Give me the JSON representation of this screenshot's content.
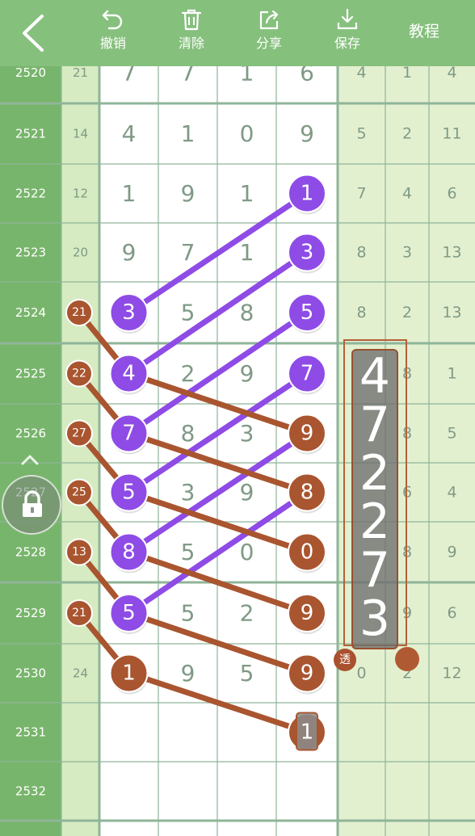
{
  "toolbar": {
    "undo_label": "撤销",
    "clear_label": "清除",
    "share_label": "分享",
    "save_label": "保存",
    "tutorial_label": "教程",
    "bg": "#86c07d"
  },
  "table": {
    "rows": [
      {
        "issue": "2520",
        "span": "21",
        "digits": [
          "7",
          "7",
          "1",
          "6"
        ],
        "stats": [
          "4",
          "1",
          "4"
        ]
      },
      {
        "issue": "2521",
        "span": "14",
        "digits": [
          "4",
          "1",
          "0",
          "9"
        ],
        "stats": [
          "5",
          "2",
          "11"
        ]
      },
      {
        "issue": "2522",
        "span": "12",
        "digits": [
          "1",
          "9",
          "1",
          ""
        ],
        "stats": [
          "7",
          "4",
          "6"
        ]
      },
      {
        "issue": "2523",
        "span": "20",
        "digits": [
          "9",
          "7",
          "1",
          ""
        ],
        "stats": [
          "8",
          "3",
          "13"
        ]
      },
      {
        "issue": "2524",
        "span": "",
        "digits": [
          "",
          "5",
          "8",
          ""
        ],
        "stats": [
          "8",
          "2",
          "13"
        ]
      },
      {
        "issue": "2525",
        "span": "",
        "digits": [
          "",
          "2",
          "9",
          ""
        ],
        "stats": [
          "",
          "8",
          "1"
        ]
      },
      {
        "issue": "2526",
        "span": "",
        "digits": [
          "",
          "8",
          "3",
          ""
        ],
        "stats": [
          "",
          "8",
          "5"
        ]
      },
      {
        "issue": "2527",
        "span": "",
        "digits": [
          "",
          "3",
          "9",
          ""
        ],
        "stats": [
          "",
          "6",
          "4"
        ]
      },
      {
        "issue": "2528",
        "span": "",
        "digits": [
          "",
          "5",
          "0",
          ""
        ],
        "stats": [
          "",
          "8",
          "9"
        ]
      },
      {
        "issue": "2529",
        "span": "",
        "digits": [
          "",
          "5",
          "2",
          ""
        ],
        "stats": [
          "",
          "9",
          "6"
        ]
      },
      {
        "issue": "2530",
        "span": "24",
        "digits": [
          "",
          "9",
          "5",
          ""
        ],
        "stats": [
          "0",
          "2",
          "12"
        ]
      },
      {
        "issue": "2531",
        "span": "",
        "digits": [
          "",
          "",
          "",
          ""
        ],
        "stats": [
          "",
          "",
          ""
        ]
      },
      {
        "issue": "2532",
        "span": "",
        "digits": [
          "",
          "",
          "",
          ""
        ],
        "stats": [
          "",
          "",
          ""
        ]
      }
    ]
  },
  "markers": {
    "purple": [
      {
        "row": 2,
        "col": 3,
        "value": "1"
      },
      {
        "row": 3,
        "col": 3,
        "value": "3"
      },
      {
        "row": 4,
        "col": 0,
        "value": "3"
      },
      {
        "row": 4,
        "col": 3,
        "value": "5"
      },
      {
        "row": 5,
        "col": 0,
        "value": "4"
      },
      {
        "row": 5,
        "col": 3,
        "value": "7"
      },
      {
        "row": 6,
        "col": 0,
        "value": "7"
      },
      {
        "row": 7,
        "col": 0,
        "value": "5"
      },
      {
        "row": 8,
        "col": 0,
        "value": "8"
      },
      {
        "row": 9,
        "col": 0,
        "value": "5"
      }
    ],
    "brown": [
      {
        "row": 10,
        "col": 0,
        "value": "1"
      },
      {
        "row": 6,
        "col": 3,
        "value": "9"
      },
      {
        "row": 7,
        "col": 3,
        "value": "8"
      },
      {
        "row": 8,
        "col": 3,
        "value": "0"
      },
      {
        "row": 9,
        "col": 3,
        "value": "9"
      },
      {
        "row": 10,
        "col": 3,
        "value": "9"
      },
      {
        "row": 11,
        "col": 3,
        "value": "1"
      }
    ],
    "span_badges": [
      {
        "row": 4,
        "value": "21"
      },
      {
        "row": 5,
        "value": "22"
      },
      {
        "row": 6,
        "value": "27"
      },
      {
        "row": 7,
        "value": "25"
      },
      {
        "row": 8,
        "value": "13"
      },
      {
        "row": 9,
        "value": "21"
      }
    ],
    "purple_lines": [
      [
        2,
        3,
        4,
        0
      ],
      [
        3,
        3,
        5,
        0
      ],
      [
        4,
        3,
        6,
        0
      ],
      [
        5,
        3,
        7,
        0
      ],
      [
        6,
        3,
        8,
        0
      ],
      [
        7,
        3,
        9,
        0
      ]
    ],
    "brown_lines": [
      [
        4,
        -1,
        5,
        0
      ],
      [
        5,
        -1,
        6,
        0
      ],
      [
        6,
        -1,
        7,
        0
      ],
      [
        7,
        -1,
        8,
        0
      ],
      [
        8,
        -1,
        9,
        0
      ],
      [
        9,
        -1,
        10,
        0
      ],
      [
        5,
        0,
        6,
        3
      ],
      [
        6,
        0,
        7,
        3
      ],
      [
        7,
        0,
        8,
        3
      ],
      [
        8,
        0,
        9,
        3
      ],
      [
        9,
        0,
        10,
        3
      ],
      [
        10,
        0,
        11,
        3
      ]
    ]
  },
  "overlay": {
    "digits": [
      "4",
      "7",
      "2",
      "2",
      "7",
      "3"
    ],
    "tou_label": "透"
  },
  "colors": {
    "purple": "#8e4be6",
    "brown": "#a9552f",
    "issue_col": "#78b56c",
    "span_col": "#d6ebc2",
    "stats_col": "#e3f0d0",
    "digit_text": "#7f9a85",
    "grid_line": "#8fb599"
  }
}
